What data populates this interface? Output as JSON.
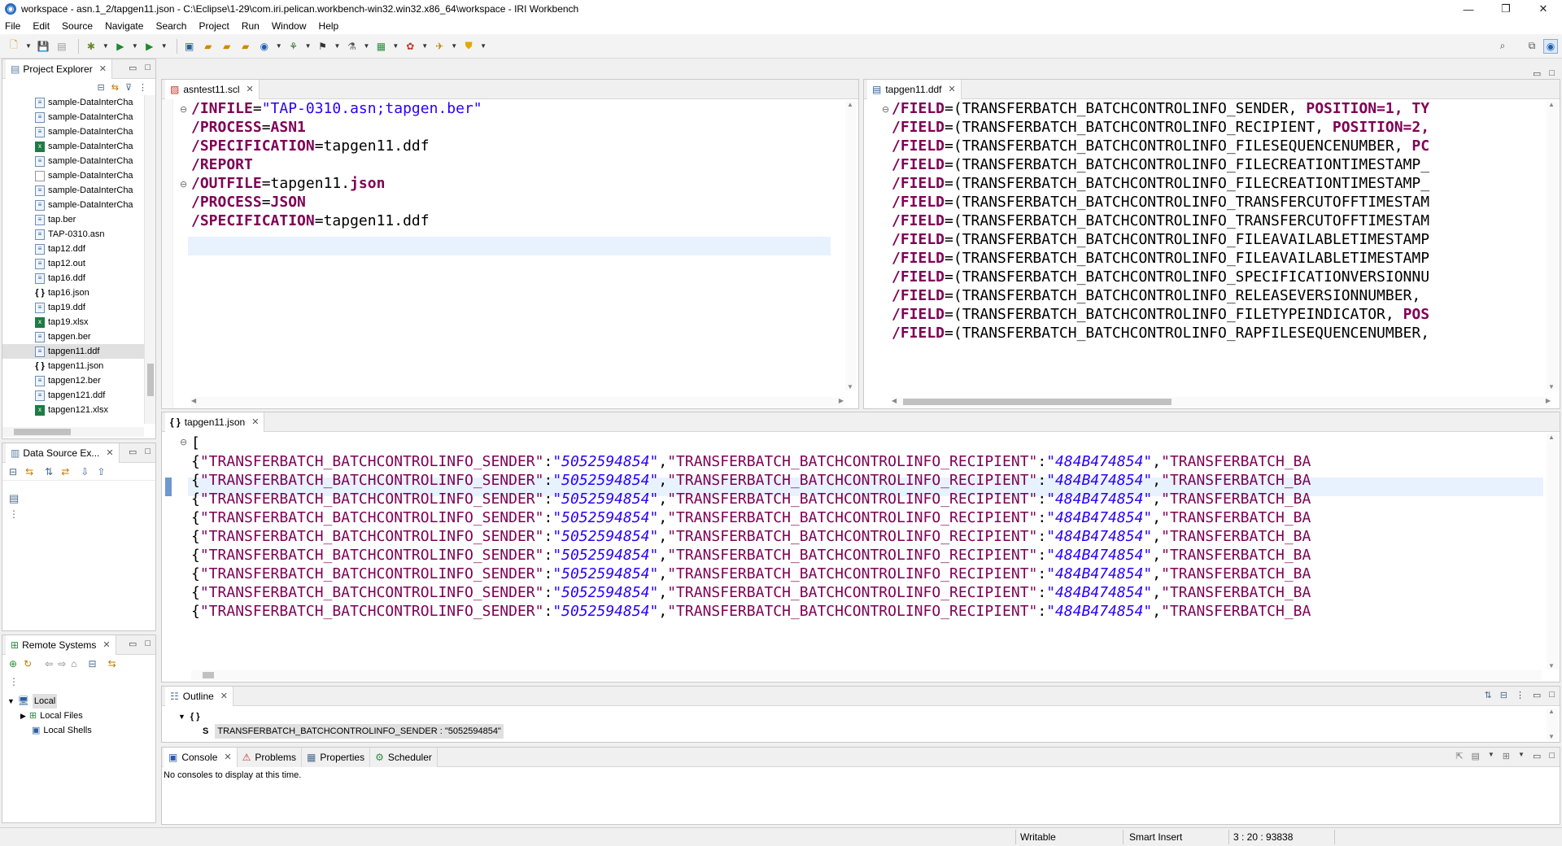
{
  "window": {
    "title": "workspace - asn.1_2/tapgen11.json - C:\\Eclipse\\1-29\\com.iri.pelican.workbench-win32.win32.x86_64\\workspace - IRI Workbench",
    "minimize": "—",
    "maximize": "❐",
    "close": "✕"
  },
  "menu": [
    "File",
    "Edit",
    "Source",
    "Navigate",
    "Search",
    "Project",
    "Run",
    "Window",
    "Help"
  ],
  "project_explorer": {
    "title": "Project Explorer",
    "files": [
      {
        "name": "sample-DataInterCha",
        "type": "ddf"
      },
      {
        "name": "sample-DataInterCha",
        "type": "ddf"
      },
      {
        "name": "sample-DataInterCha",
        "type": "ddf"
      },
      {
        "name": "sample-DataInterCha",
        "type": "xlsx"
      },
      {
        "name": "sample-DataInterCha",
        "type": "ddf"
      },
      {
        "name": "sample-DataInterCha",
        "type": "blank"
      },
      {
        "name": "sample-DataInterCha",
        "type": "ddf"
      },
      {
        "name": "sample-DataInterCha",
        "type": "ddf"
      },
      {
        "name": "tap.ber",
        "type": "ddf"
      },
      {
        "name": "TAP-0310.asn",
        "type": "ddf"
      },
      {
        "name": "tap12.ddf",
        "type": "ddf"
      },
      {
        "name": "tap12.out",
        "type": "ddf"
      },
      {
        "name": "tap16.ddf",
        "type": "ddf"
      },
      {
        "name": "tap16.json",
        "type": "json"
      },
      {
        "name": "tap19.ddf",
        "type": "ddf"
      },
      {
        "name": "tap19.xlsx",
        "type": "xlsx"
      },
      {
        "name": "tapgen.ber",
        "type": "ddf"
      },
      {
        "name": "tapgen11.ddf",
        "type": "ddf",
        "selected": true
      },
      {
        "name": "tapgen11.json",
        "type": "json"
      },
      {
        "name": "tapgen12.ber",
        "type": "ddf"
      },
      {
        "name": "tapgen121.ddf",
        "type": "ddf"
      },
      {
        "name": "tapgen121.xlsx",
        "type": "xlsx"
      }
    ]
  },
  "data_source_explorer": {
    "title": "Data Source Ex..."
  },
  "remote_systems": {
    "title": "Remote Systems",
    "root": "Local",
    "children": [
      "Local Files",
      "Local Shells"
    ]
  },
  "editor_scl": {
    "tab": "asntest11.scl",
    "lines": [
      {
        "key": "/INFILE",
        "eq": "=",
        "val": "\"TAP-0310.asn;tapgen.ber\"",
        "kind": "str"
      },
      {
        "key": "/PROCESS",
        "eq": "=",
        "val": "ASN1",
        "kind": "kw"
      },
      {
        "key": "/SPECIFICATION",
        "eq": "=",
        "val": "tapgen11.ddf",
        "kind": "plain"
      },
      {
        "key": "/REPORT",
        "eq": "",
        "val": "",
        "kind": "plain"
      },
      {
        "key": "/OUTFILE",
        "eq": "=",
        "val": "tapgen11.",
        "val2": "json",
        "kind": "mixed"
      },
      {
        "key": "/PROCESS",
        "eq": "=",
        "val": "JSON",
        "kind": "kw"
      },
      {
        "key": "/SPECIFICATION",
        "eq": "=",
        "val": "tapgen11.ddf",
        "kind": "plain"
      }
    ]
  },
  "editor_ddf": {
    "tab": "tapgen11.ddf",
    "lines": [
      {
        "key": "/FIELD",
        "rest": "=(TRANSFERBATCH_BATCHCONTROLINFO_SENDER, ",
        "extra": "POSITION=1, TY"
      },
      {
        "key": "/FIELD",
        "rest": "=(TRANSFERBATCH_BATCHCONTROLINFO_RECIPIENT, ",
        "extra": "POSITION=2,"
      },
      {
        "key": "/FIELD",
        "rest": "=(TRANSFERBATCH_BATCHCONTROLINFO_FILESEQUENCENUMBER, ",
        "extra": "PC"
      },
      {
        "key": "/FIELD",
        "rest": "=(TRANSFERBATCH_BATCHCONTROLINFO_FILECREATIONTIMESTAMP_",
        "extra": ""
      },
      {
        "key": "/FIELD",
        "rest": "=(TRANSFERBATCH_BATCHCONTROLINFO_FILECREATIONTIMESTAMP_",
        "extra": ""
      },
      {
        "key": "/FIELD",
        "rest": "=(TRANSFERBATCH_BATCHCONTROLINFO_TRANSFERCUTOFFTIMESTAM",
        "extra": ""
      },
      {
        "key": "/FIELD",
        "rest": "=(TRANSFERBATCH_BATCHCONTROLINFO_TRANSFERCUTOFFTIMESTAM",
        "extra": ""
      },
      {
        "key": "/FIELD",
        "rest": "=(TRANSFERBATCH_BATCHCONTROLINFO_FILEAVAILABLETIMESTAMP",
        "extra": ""
      },
      {
        "key": "/FIELD",
        "rest": "=(TRANSFERBATCH_BATCHCONTROLINFO_FILEAVAILABLETIMESTAMP",
        "extra": ""
      },
      {
        "key": "/FIELD",
        "rest": "=(TRANSFERBATCH_BATCHCONTROLINFO_SPECIFICATIONVERSIONNU",
        "extra": ""
      },
      {
        "key": "/FIELD",
        "rest": "=(TRANSFERBATCH_BATCHCONTROLINFO_RELEASEVERSIONNUMBER, ",
        "extra": ""
      },
      {
        "key": "/FIELD",
        "rest": "=(TRANSFERBATCH_BATCHCONTROLINFO_FILETYPEINDICATOR, ",
        "extra": "POS"
      },
      {
        "key": "/FIELD",
        "rest": "=(TRANSFERBATCH_BATCHCONTROLINFO_RAPFILESEQUENCENUMBER,",
        "extra": ""
      }
    ]
  },
  "editor_json": {
    "tab": "tapgen11.json",
    "open_bracket": "[",
    "row": {
      "brace": "{",
      "k1": "\"TRANSFERBATCH_BATCHCONTROLINFO_SENDER\"",
      "colon": ":",
      "v1": "\"5052594854\"",
      "comma": ",",
      "k2": "\"TRANSFERBATCH_BATCHCONTROLINFO_RECIPIENT\"",
      "v2": "\"484B474854\"",
      "k3": "\"TRANSFERBATCH_BA"
    },
    "row_count": 9
  },
  "outline": {
    "title": "Outline",
    "root": "{ }",
    "item_badge": "S",
    "item": "TRANSFERBATCH_BATCHCONTROLINFO_SENDER : \"5052594854\""
  },
  "console_tabs": [
    "Console",
    "Problems",
    "Properties",
    "Scheduler"
  ],
  "console_message": "No consoles to display at this time.",
  "status": {
    "writable": "Writable",
    "insert_mode": "Smart Insert",
    "position": "3 : 20 : 93838"
  }
}
